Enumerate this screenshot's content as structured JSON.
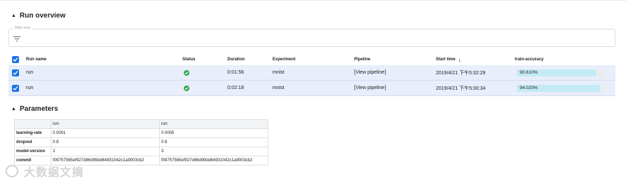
{
  "sections": {
    "runs_title": "Run overview",
    "params_title": "Parameters"
  },
  "filter": {
    "label": "Filter runs"
  },
  "table": {
    "columns": {
      "run_name": "Run name",
      "status": "Status",
      "duration": "Duration",
      "experiment": "Experiment",
      "pipeline": "Pipeline",
      "start_time": "Start time",
      "metric": "train-accuracy"
    },
    "rows": [
      {
        "name": "run",
        "status": "success",
        "duration": "0:01:56",
        "experiment": "mnist",
        "pipeline": "[View pipeline]",
        "start_time": "2019/4/21 下午5:32:29",
        "metric_text": "90.610%",
        "metric_value": 0.9061
      },
      {
        "name": "run",
        "status": "success",
        "duration": "0:02:18",
        "experiment": "mnist",
        "pipeline": "[View pipeline]",
        "start_time": "2019/4/21 下午5:30:34",
        "metric_text": "94.020%",
        "metric_value": 0.9402
      }
    ]
  },
  "parameters": {
    "headers": [
      "",
      "run",
      "run"
    ],
    "rows": [
      {
        "key": "learning-rate",
        "values": [
          "0.0001",
          "0.0005"
        ]
      },
      {
        "key": "dropout",
        "values": [
          "0.8",
          "0.8"
        ]
      },
      {
        "key": "model-version",
        "values": [
          "2",
          "3"
        ]
      },
      {
        "key": "commit",
        "values": [
          "f09757565ef927d86d99dd64931042c1a9003cb2",
          "f09757565ef927d86d99dd64931042c1a9003cb2"
        ]
      }
    ]
  },
  "watermark": {
    "text": "大数据文摘"
  },
  "colors": {
    "accent": "#1a73e8",
    "success": "#34a853",
    "selected_row": "#e8eefa",
    "metric_bar": "#c4ebf5"
  }
}
